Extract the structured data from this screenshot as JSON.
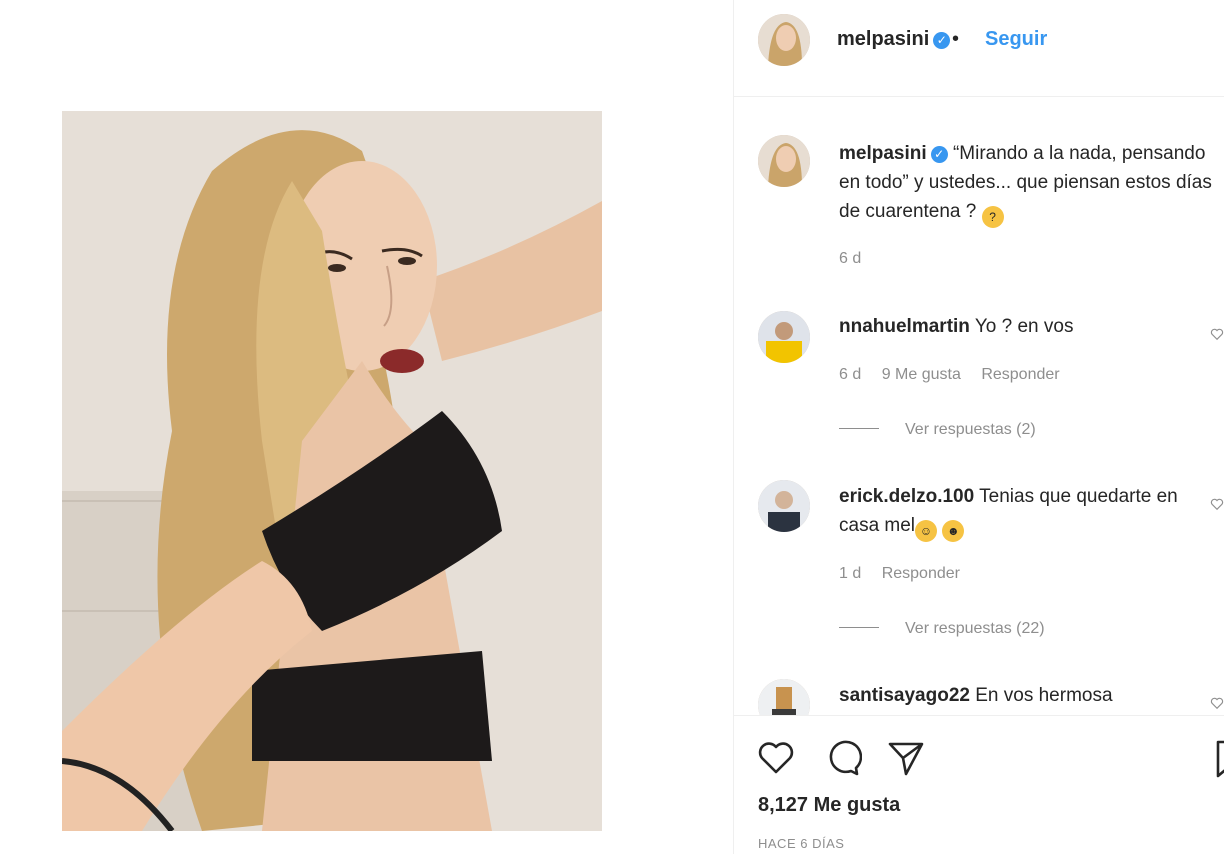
{
  "header": {
    "username": "melpasini",
    "separator": "•",
    "follow_label": "Seguir"
  },
  "caption": {
    "username": "melpasini",
    "text": "“Mirando a la nada, pensando en todo” y ustedes... que piensan estos días de cuarentena ?",
    "time": "6 d"
  },
  "comments": [
    {
      "username": "nnahuelmartin",
      "text": "Yo ? en vos",
      "time": "6 d",
      "likes": "9 Me gusta",
      "reply_label": "Responder",
      "view_replies": "Ver respuestas (2)"
    },
    {
      "username": "erick.delzo.100",
      "text": "Tenias que quedarte en casa mel",
      "time": "1 d",
      "reply_label": "Responder",
      "view_replies": "Ver respuestas (22)"
    },
    {
      "username": "santisayago22",
      "text": "En vos hermosa"
    }
  ],
  "actions": {
    "likes_count": "8,127 Me gusta",
    "date": "HACE 6 DÍAS"
  },
  "colors": {
    "accent": "#3897f0",
    "text": "#262626",
    "muted": "#8e8e8e",
    "border": "#efefef"
  }
}
